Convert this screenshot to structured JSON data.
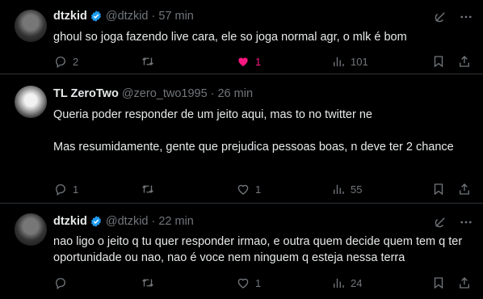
{
  "tweets": [
    {
      "name": "dtzkid",
      "handle": "@dtzkid",
      "sep": "·",
      "time": "57 min",
      "text": "ghoul so joga fazendo live cara, ele so joga normal agr, o mlk é bom",
      "replies": "2",
      "retweets": "",
      "likes": "1",
      "views": "101",
      "verified": true,
      "liked": true
    },
    {
      "name": "TL ZeroTwo",
      "handle": "@zero_two1995",
      "sep": "·",
      "time": "26 min",
      "text_p1": "Queria poder responder de um jeito aqui, mas to no twitter ne",
      "text_p2": "Mas resumidamente, gente que prejudica pessoas boas, n deve ter 2 chance",
      "replies": "1",
      "retweets": "",
      "likes": "1",
      "views": "55",
      "verified": false,
      "liked": false
    },
    {
      "name": "dtzkid",
      "handle": "@dtzkid",
      "sep": "·",
      "time": "22 min",
      "text": "nao ligo o jeito q tu quer responder irmao, e outra quem decide quem tem q ter oportunidade ou nao, nao é voce nem ninguem q esteja nessa terra",
      "replies": "",
      "retweets": "",
      "likes": "1",
      "views": "24",
      "verified": true,
      "liked": false
    }
  ],
  "colors": {
    "background": "#000000",
    "text": "#e7e9ea",
    "muted": "#71767b",
    "verified": "#1d9bf0",
    "like": "#f91880",
    "divider": "#2f3336"
  }
}
